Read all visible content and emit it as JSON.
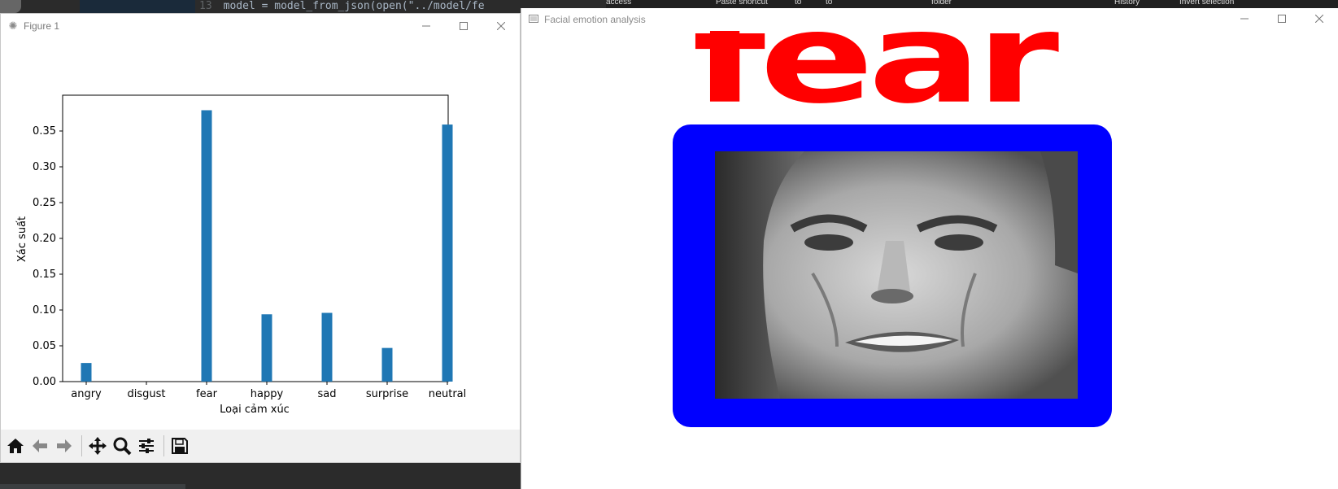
{
  "background": {
    "code_line_number": "13",
    "code_text": "model = model_from_json(open(\"../model/fe",
    "ribbon_items": [
      "access",
      "Paste shortcut",
      "to",
      "to",
      "folder",
      "History",
      "Invert selection"
    ]
  },
  "figure_window": {
    "title": "Figure 1",
    "icon": "matplotlib-icon",
    "controls": {
      "minimize": "minimize-icon",
      "maximize": "maximize-icon",
      "close": "close-icon"
    },
    "toolbar": [
      "home-icon",
      "back-arrow-icon",
      "forward-arrow-icon",
      "pan-icon",
      "zoom-icon",
      "configure-subplots-icon",
      "save-icon"
    ]
  },
  "chart_data": {
    "type": "bar",
    "categories": [
      "angry",
      "disgust",
      "fear",
      "happy",
      "sad",
      "surprise",
      "neutral"
    ],
    "values": [
      0.026,
      0.0,
      0.379,
      0.094,
      0.096,
      0.047,
      0.359
    ],
    "xlabel": "Loại cảm xúc",
    "ylabel": "Xác suất",
    "ylim": [
      0,
      0.4
    ],
    "yticks": [
      "0.00",
      "0.05",
      "0.10",
      "0.15",
      "0.20",
      "0.25",
      "0.30",
      "0.35"
    ],
    "bar_color": "#1f77b4",
    "grid": false
  },
  "face_window": {
    "title": "Facial emotion analysis",
    "detected_emotion": "fear",
    "label_color": "#ff0000",
    "box_color": "#0000ff"
  }
}
